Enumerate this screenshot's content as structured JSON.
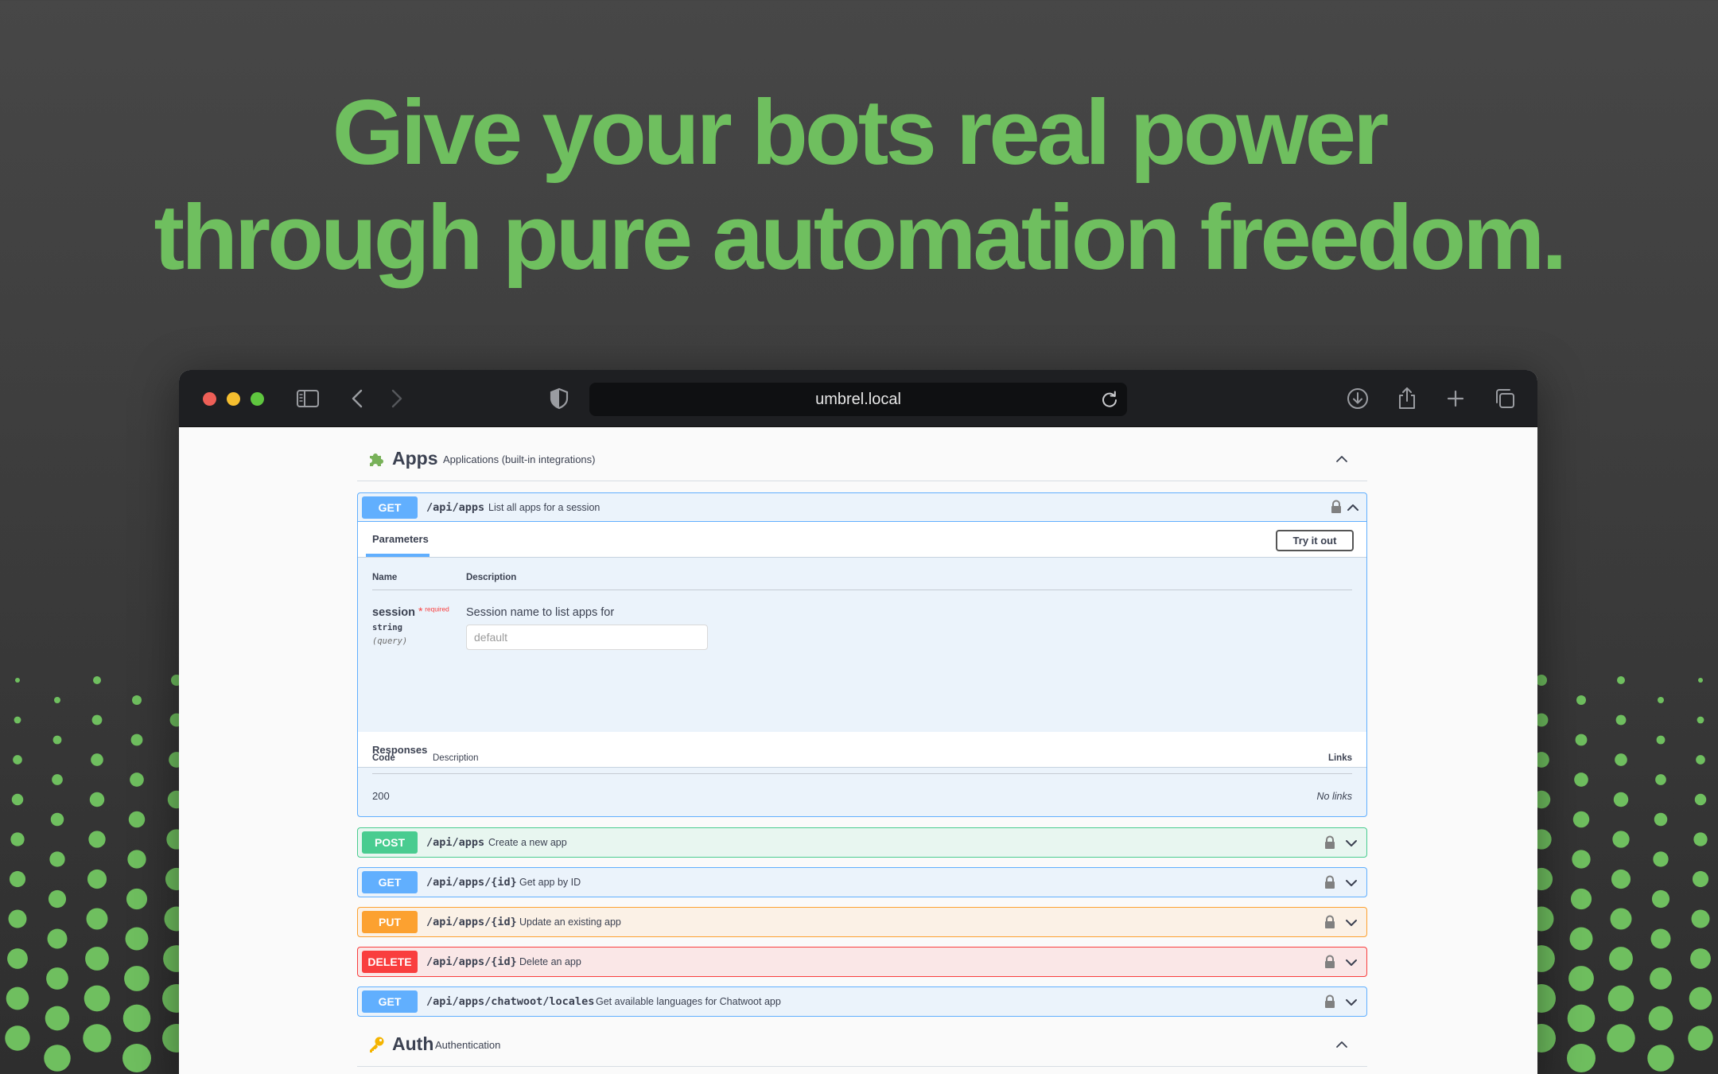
{
  "headline": {
    "line1": "Give your bots real power",
    "line2": "through pure automation freedom."
  },
  "colors": {
    "accent_green": "#6fbf5f",
    "get": "#61affe",
    "post": "#49cc90",
    "put": "#fca130",
    "delete": "#f93e3e"
  },
  "browser": {
    "url": "umbrel.local",
    "icons": [
      "sidebar-icon",
      "back-icon",
      "forward-icon",
      "shield-icon",
      "reload-icon",
      "download-icon",
      "share-icon",
      "new-tab-icon",
      "tab-overview-icon"
    ]
  },
  "apps_section": {
    "title": "Apps",
    "subtitle": "Applications (built-in integrations)"
  },
  "expanded_op": {
    "method": "GET",
    "path": "/api/apps",
    "description": "List all apps for a session",
    "tab_label": "Parameters",
    "try_label": "Try it out",
    "params_header": {
      "name": "Name",
      "description": "Description"
    },
    "param": {
      "name": "session",
      "required_star": "*",
      "required_label": "required",
      "type": "string",
      "in": "(query)",
      "description": "Session name to list apps for",
      "placeholder": "default"
    },
    "responses_title": "Responses",
    "responses_header": {
      "code": "Code",
      "description": "Description",
      "links": "Links"
    },
    "response": {
      "code": "200",
      "links": "No links"
    }
  },
  "operations": [
    {
      "method": "POST",
      "path": "/api/apps",
      "description": "Create a new app"
    },
    {
      "method": "GET",
      "path": "/api/apps/{id}",
      "description": "Get app by ID"
    },
    {
      "method": "PUT",
      "path": "/api/apps/{id}",
      "description": "Update an existing app"
    },
    {
      "method": "DELETE",
      "path": "/api/apps/{id}",
      "description": "Delete an app"
    },
    {
      "method": "GET",
      "path": "/api/apps/chatwoot/locales",
      "description": "Get available languages for Chatwoot app"
    }
  ],
  "auth_section": {
    "title": "Auth",
    "subtitle": "Authentication"
  }
}
